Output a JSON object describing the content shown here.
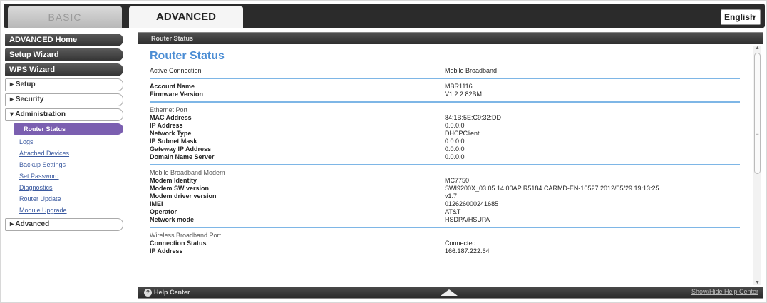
{
  "tabs": {
    "basic": "BASIC",
    "advanced": "ADVANCED"
  },
  "language": {
    "selected": "English"
  },
  "sidebar": {
    "top_buttons": [
      "ADVANCED Home",
      "Setup Wizard",
      "WPS Wizard"
    ],
    "sections": [
      {
        "label": "▸ Setup"
      },
      {
        "label": "▸ Security"
      },
      {
        "label": "▾ Administration"
      }
    ],
    "admin_items": [
      "Router Status",
      "Logs",
      "Attached Devices",
      "Backup Settings",
      "Set Password",
      "Diagnostics",
      "Router Update",
      "Module Upgrade"
    ],
    "advanced": "▸ Advanced"
  },
  "main": {
    "header": "Router Status",
    "title": "Router Status",
    "active_connection": {
      "label": "Active Connection",
      "value": "Mobile Broadband"
    },
    "account": [
      {
        "label": "Account Name",
        "value": "MBR1116"
      },
      {
        "label": "Firmware Version",
        "value": "V1.2.2.82BM"
      }
    ],
    "ethernet_title": "Ethernet Port",
    "ethernet": [
      {
        "label": "MAC Address",
        "value": "84:1B:5E:C9:32:DD"
      },
      {
        "label": "IP Address",
        "value": "0.0.0.0"
      },
      {
        "label": "Network Type",
        "value": "DHCPClient"
      },
      {
        "label": "IP Subnet Mask",
        "value": "0.0.0.0"
      },
      {
        "label": "Gateway IP Address",
        "value": "0.0.0.0"
      },
      {
        "label": "Domain Name Server",
        "value": "0.0.0.0"
      }
    ],
    "modem_title": "Mobile Broadband Modem",
    "modem": [
      {
        "label": "Modem Identity",
        "value": "MC7750"
      },
      {
        "label": "Modem SW version",
        "value": "SWI9200X_03.05.14.00AP R5184 CARMD-EN-10527 2012/05/29 19:13:25"
      },
      {
        "label": "Modem driver version",
        "value": "v1.7"
      },
      {
        "label": "IMEI",
        "value": "012626000241685"
      },
      {
        "label": "Operator",
        "value": "AT&T"
      },
      {
        "label": "Network mode",
        "value": "HSDPA/HSUPA"
      }
    ],
    "wireless_title": "Wireless Broadband Port",
    "wireless": [
      {
        "label": "Connection Status",
        "value": "Connected"
      },
      {
        "label": "IP Address",
        "value": "166.187.222.64"
      }
    ]
  },
  "footer": {
    "help": "Help Center",
    "show_hide": "Show/Hide Help Center"
  }
}
